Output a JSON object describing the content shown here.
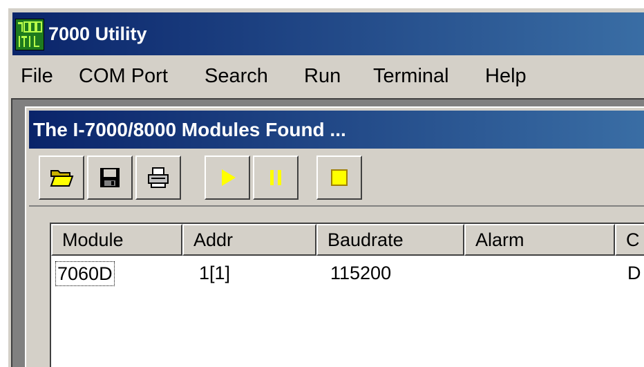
{
  "window": {
    "title": "7000 Utility",
    "icon": "7000-utility-app-icon",
    "title_bar_color": "#0a246a"
  },
  "menu": {
    "items": [
      {
        "label": "File"
      },
      {
        "label": "COM Port"
      },
      {
        "label": "Search"
      },
      {
        "label": "Run"
      },
      {
        "label": "Terminal"
      },
      {
        "label": "Help"
      }
    ]
  },
  "child_window": {
    "title": "The I-7000/8000 Modules Found ..."
  },
  "toolbar": {
    "buttons": [
      {
        "icon": "folder-open-icon"
      },
      {
        "icon": "floppy-save-icon"
      },
      {
        "icon": "printer-icon"
      },
      {
        "icon": "run-play-icon",
        "state": "disabled"
      },
      {
        "icon": "pause-icon",
        "state": "disabled"
      },
      {
        "icon": "stop-icon"
      }
    ]
  },
  "list": {
    "columns": [
      "Module",
      "Addr",
      "Baudrate",
      "Alarm",
      "C"
    ],
    "rows": [
      {
        "module": "7060D",
        "addr": "1[1]",
        "baudrate": "115200",
        "alarm": "",
        "c": "D"
      }
    ]
  },
  "colors": {
    "face": "#d4d0c8",
    "accent_yellow": "#ffff00"
  }
}
